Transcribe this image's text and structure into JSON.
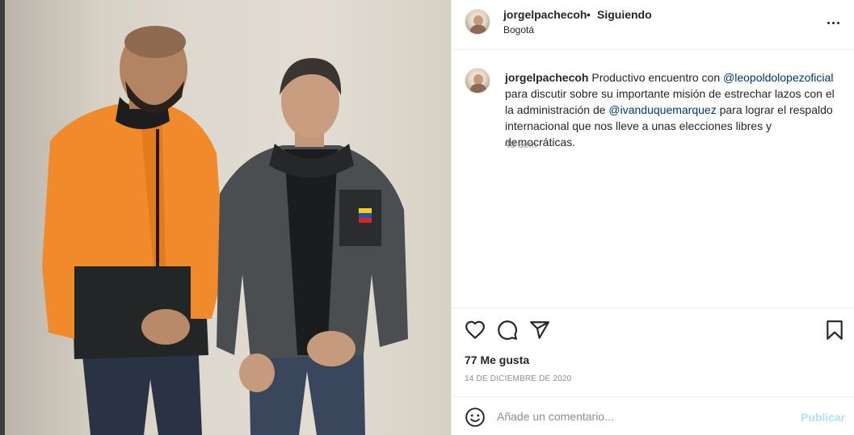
{
  "post": {
    "photo_alt": "",
    "header": {
      "username": "jorgelpacheсoh",
      "separator": "•",
      "follow_status": "Siguiendo",
      "location": "Bogotá"
    },
    "caption": {
      "username": "jorgelpachecoh",
      "text_1": " Productivo encuentro con ",
      "mention_1": "@leopoldolopezoficial",
      "text_2": " para discutir sobre su importante misión de estrechar lazos con el la administración de ",
      "mention_2": "@ivanduquemarquez",
      "text_3": " para lograr el respaldo internacional que nos lleve a unas elecciones libres y democráticas.",
      "time_ago": "48 sem"
    },
    "likes": "77 Me gusta",
    "date": "14 DE DICIEMBRE DE 2020",
    "comment": {
      "placeholder": "Añade un comentario...",
      "publish_label": "Publicar"
    }
  },
  "icons": {
    "like": "heart-icon",
    "comment": "speech-bubble-icon",
    "share": "paper-plane-icon",
    "save": "bookmark-icon",
    "emoji": "smiley-icon",
    "more": "ellipsis-icon"
  },
  "colors": {
    "text": "#262626",
    "secondary": "#8e8e8e",
    "mention": "#00376b",
    "publish_disabled": "#b2dffc",
    "divider": "#efefef"
  }
}
